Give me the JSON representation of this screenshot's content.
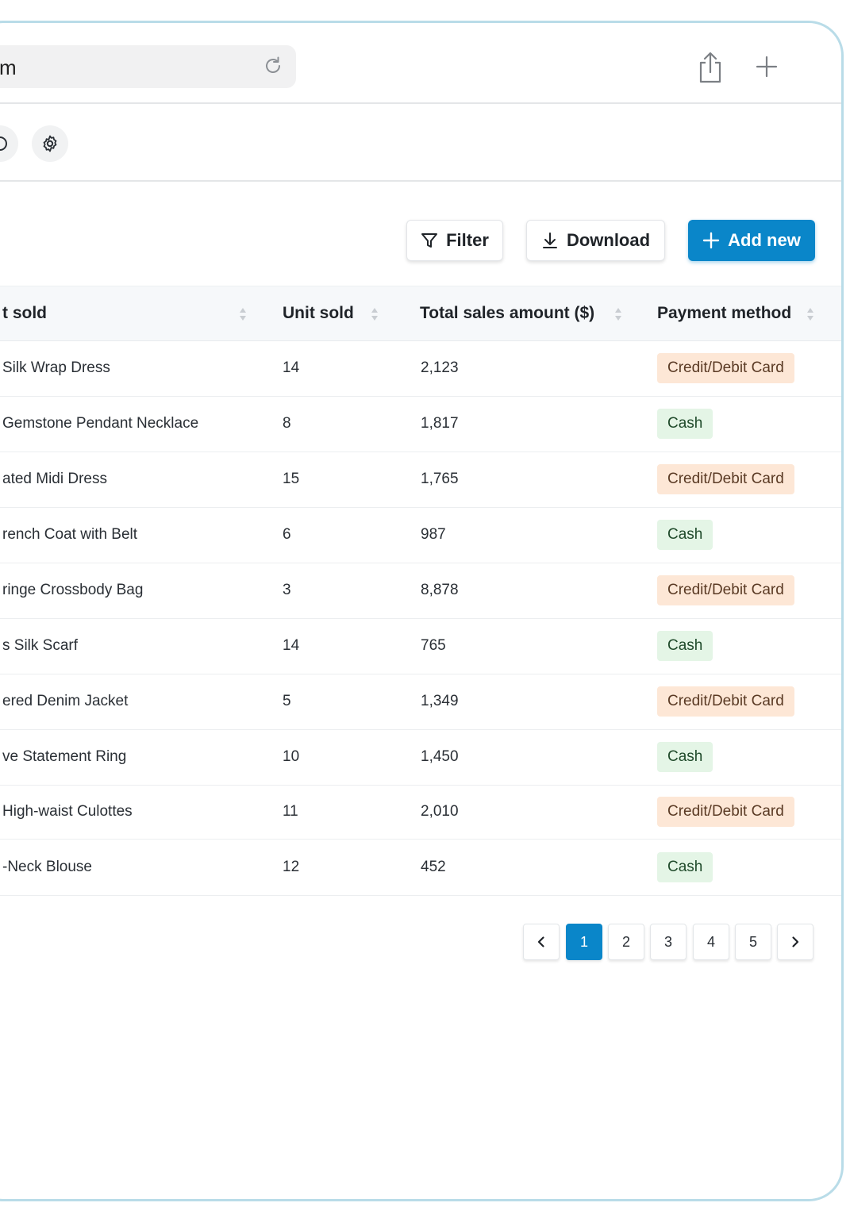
{
  "browser": {
    "url_fragment": "m",
    "reload_icon": "reload-icon",
    "share_icon": "share-icon",
    "new_tab_icon": "plus-icon"
  },
  "toolbar": {
    "partial_icon": "circle-icon",
    "settings_icon": "gear-icon"
  },
  "actions": {
    "filter_label": "Filter",
    "download_label": "Download",
    "add_label": "Add new"
  },
  "table": {
    "columns": [
      "t sold",
      "Unit sold",
      "Total sales amount ($)",
      "Payment method"
    ],
    "rows": [
      {
        "product": "Silk Wrap Dress",
        "units": "14",
        "total": "2,123",
        "payment": "Credit/Debit Card"
      },
      {
        "product": "Gemstone Pendant Necklace",
        "units": "8",
        "total": "1,817",
        "payment": "Cash"
      },
      {
        "product": "ated Midi Dress",
        "units": "15",
        "total": "1,765",
        "payment": "Credit/Debit Card"
      },
      {
        "product": "rench Coat with Belt",
        "units": "6",
        "total": "987",
        "payment": "Cash"
      },
      {
        "product": "ringe Crossbody Bag",
        "units": "3",
        "total": "8,878",
        "payment": "Credit/Debit Card"
      },
      {
        "product": "s Silk Scarf",
        "units": "14",
        "total": "765",
        "payment": "Cash"
      },
      {
        "product": "ered Denim Jacket",
        "units": "5",
        "total": "1,349",
        "payment": "Credit/Debit Card"
      },
      {
        "product": "ve Statement Ring",
        "units": "10",
        "total": "1,450",
        "payment": "Cash"
      },
      {
        "product": "High-waist Culottes",
        "units": "11",
        "total": "2,010",
        "payment": "Credit/Debit Card"
      },
      {
        "product": "-Neck Blouse",
        "units": "12",
        "total": "452",
        "payment": "Cash"
      }
    ]
  },
  "pagination": {
    "pages": [
      "1",
      "2",
      "3",
      "4",
      "5"
    ],
    "current": "1"
  },
  "colors": {
    "accent": "#0a86c9",
    "card_badge": "#fde7d6",
    "cash_badge": "#e4f5e6",
    "frame": "#b9dce8"
  }
}
